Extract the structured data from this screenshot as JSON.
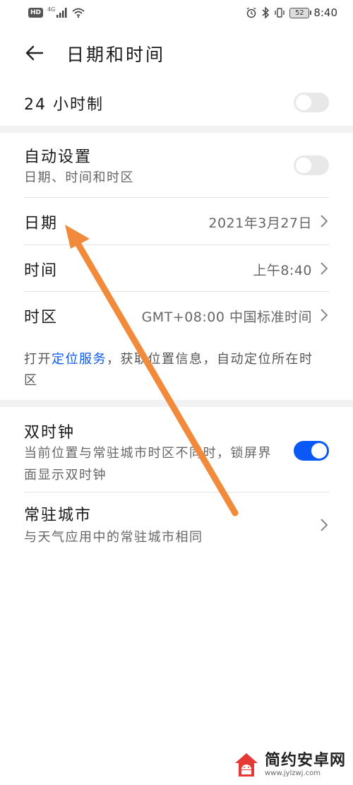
{
  "status_bar": {
    "hd": "HD",
    "network": "4G",
    "battery": "52",
    "time": "8:40"
  },
  "header": {
    "title": "日期和时间",
    "back_icon": "arrow-left-icon"
  },
  "settings": {
    "hour24": {
      "label": "24 小时制",
      "enabled": false
    },
    "auto": {
      "label": "自动设置",
      "sub": "日期、时间和时区",
      "enabled": false
    },
    "date": {
      "label": "日期",
      "value": "2021年3月27日"
    },
    "time": {
      "label": "时间",
      "value": "上午8:40"
    },
    "timezone": {
      "label": "时区",
      "value": "GMT+08:00 中国标准时间"
    },
    "note": {
      "prefix": "打开",
      "link": "定位服务",
      "suffix": "，获取位置信息，自动定位所在时区"
    },
    "dual_clock": {
      "label": "双时钟",
      "sub": "当前位置与常驻城市时区不同时，锁屏界面显示双时钟",
      "enabled": true
    },
    "home_city": {
      "label": "常驻城市",
      "sub": "与天气应用中的常驻城市相同"
    }
  },
  "colors": {
    "accent": "#0a59f7",
    "annotation_arrow": "#f28a3c"
  },
  "watermark": {
    "title": "简约安卓网",
    "url": "www.jylzwj.com"
  }
}
